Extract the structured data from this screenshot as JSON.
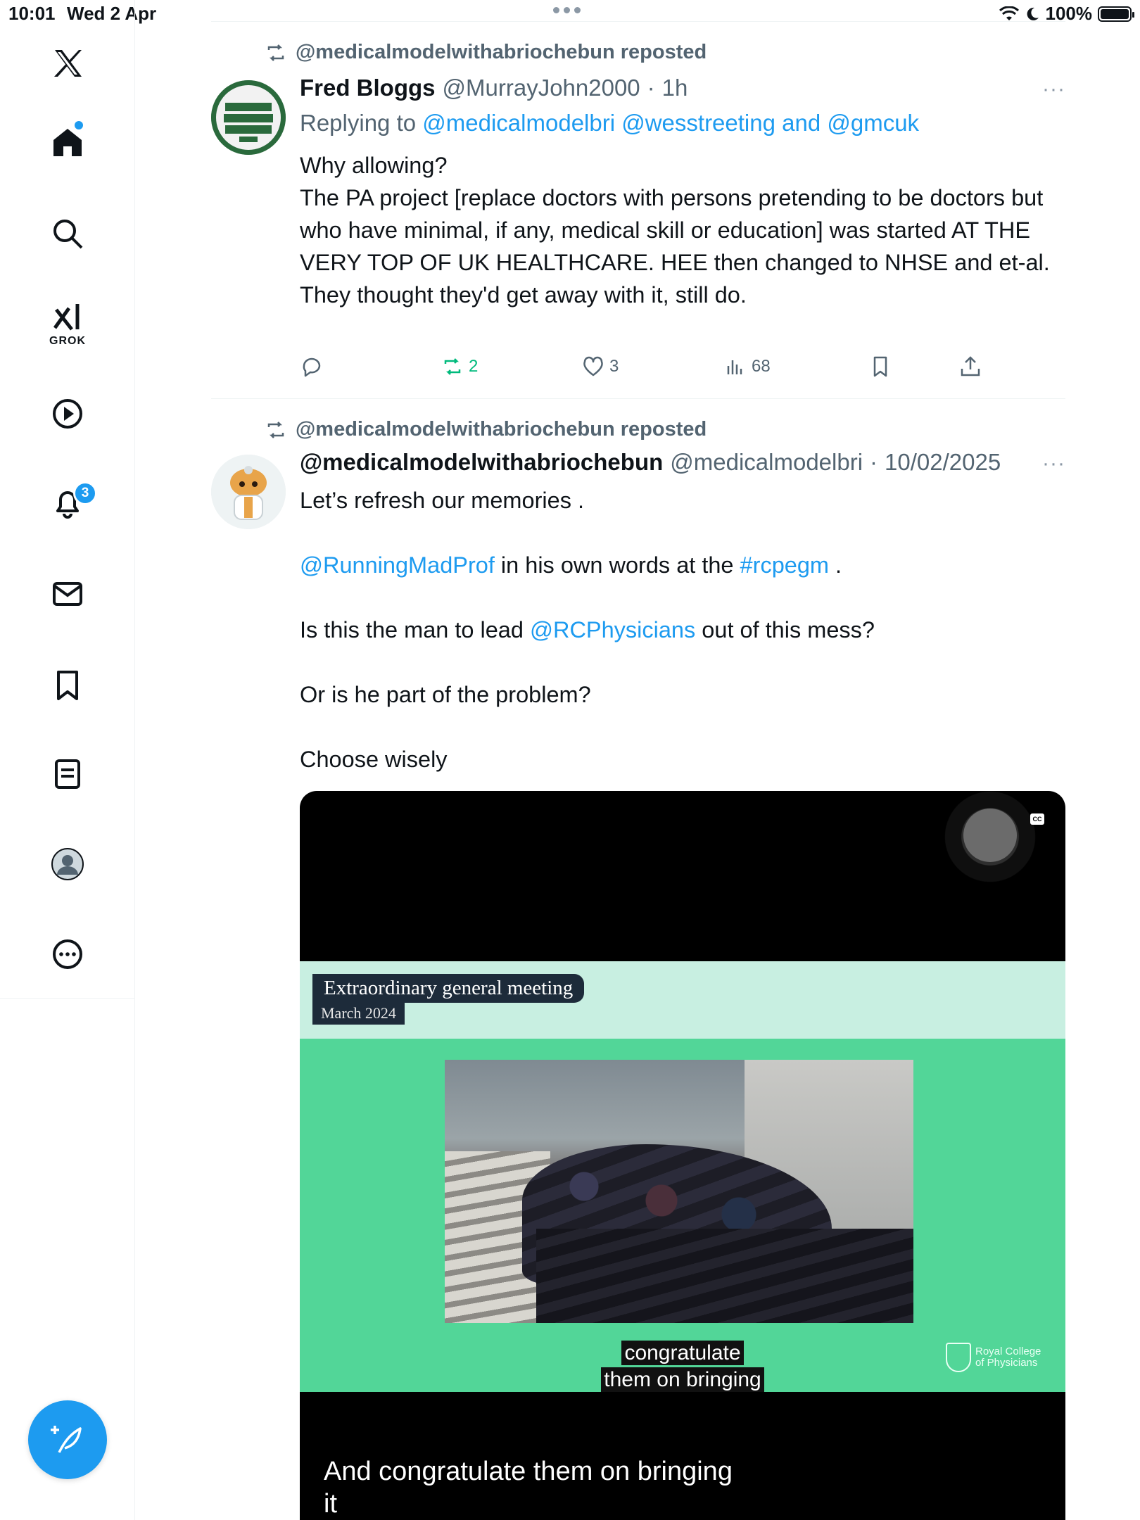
{
  "status_bar": {
    "time": "10:01",
    "date": "Wed 2 Apr",
    "battery": "100%"
  },
  "sidebar": {
    "grok_label": "GROK",
    "notification_count": "3",
    "icons": [
      "x-logo-icon",
      "home-icon",
      "search-icon",
      "grok-icon",
      "video-icon",
      "bell-icon",
      "mail-icon",
      "bookmark-icon",
      "lists-icon",
      "profile-icon",
      "more-icon"
    ]
  },
  "tweets": [
    {
      "repost_by": "@medicalmodelwithabriochebun reposted",
      "name": "Fred Bloggs",
      "handle": "@MurrayJohn2000",
      "dot": "·",
      "time": "1h",
      "more": "···",
      "replying_prefix": "Replying to",
      "replying_to": "@medicalmodelbri @wesstreeting and @gmcuk",
      "body": [
        "Why allowing?",
        "The PA project [replace doctors with persons pretending to be doctors but who have minimal, if any, medical skill or education] was started AT THE VERY TOP OF UK HEALTHCARE. HEE then changed to NHSE and et-al.",
        "They thought they'd get away with it, still do."
      ],
      "retweets": "2",
      "likes": "3",
      "views": "68"
    },
    {
      "repost_by": "@medicalmodelwithabriochebun reposted",
      "name": "@medicalmodelwithabriochebun",
      "handle": "@medicalmodelbri",
      "dot": "·",
      "time": "10/02/2025",
      "more": "···",
      "line1": "Let’s refresh our memories .",
      "mention1": "@RunningMadProf",
      "line2_mid": " in his own words at the ",
      "hashtag": "#rcpegm",
      "line2_end": " .",
      "line3_pre": "Is this the man to lead ",
      "mention2": "@RCPhysicians",
      "line3_post": " out of this mess?",
      "line4": "Or is he part of the problem?",
      "line5": "Choose wisely",
      "video": {
        "banner_title": "Extraordinary general meeting",
        "banner_date": "March 2024",
        "caption_line1": "congratulate",
        "caption_line2": "them on bringing",
        "logo_line1": "Royal College",
        "logo_line2": "of Physicians",
        "subtitle_line1": "And congratulate them on bringing",
        "subtitle_line2": "it",
        "cc": "CC"
      }
    }
  ],
  "colors": {
    "accent": "#1d9bf0",
    "retweet_green": "#00ba7c",
    "video_green": "#52d698",
    "video_band": "#c8efe1"
  }
}
